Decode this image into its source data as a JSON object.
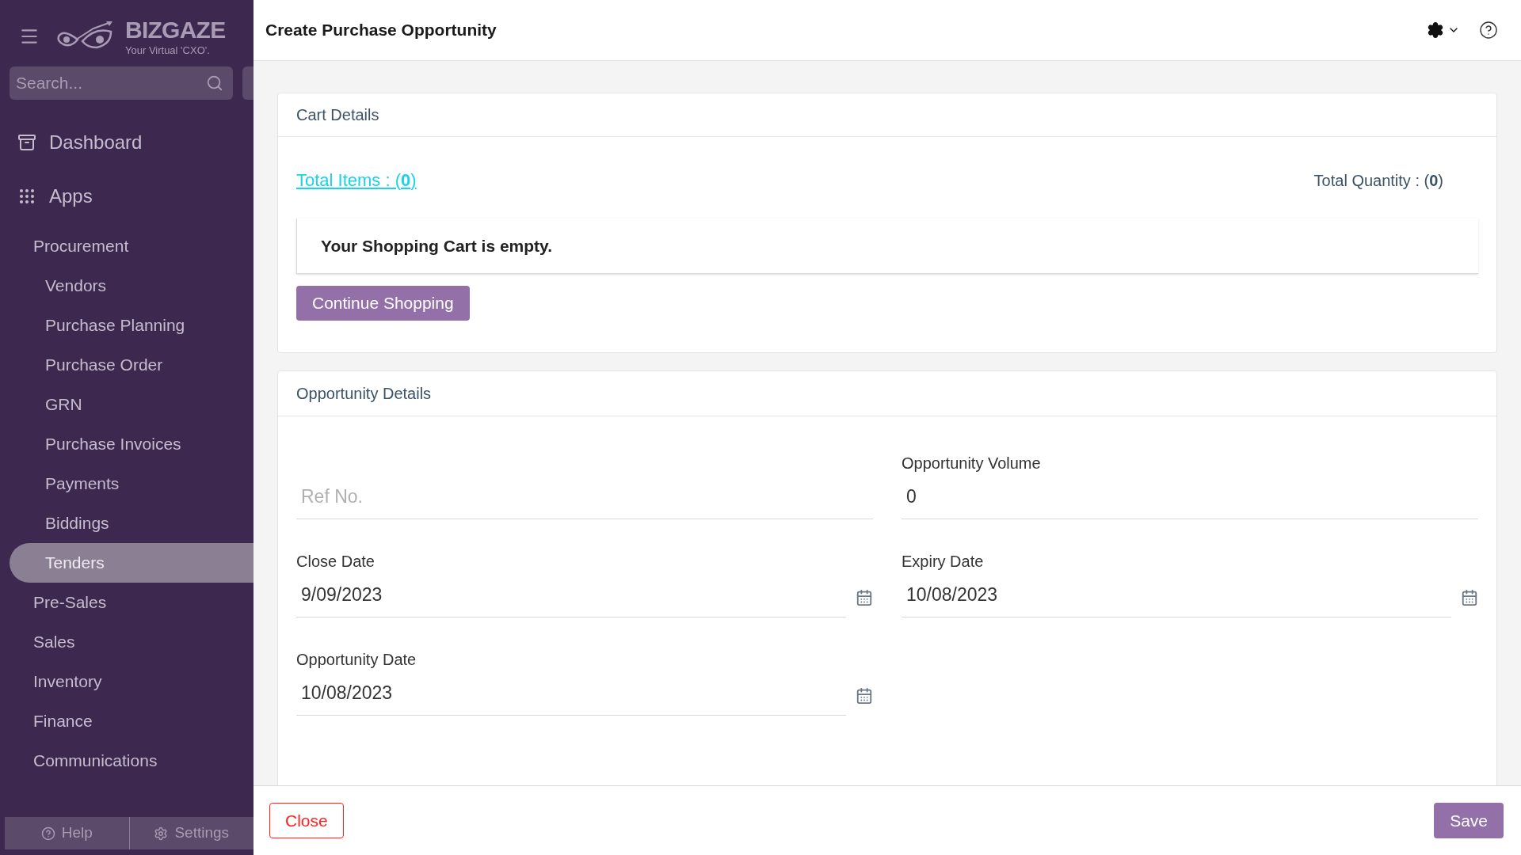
{
  "sidebar": {
    "logo": {
      "name": "BIZGAZE",
      "tagline": "Your Virtual 'CXO'."
    },
    "search": {
      "placeholder": "Search..."
    },
    "sections": [
      {
        "kind": "dashboard",
        "label": "Dashboard"
      },
      {
        "kind": "apps",
        "label": "Apps"
      }
    ],
    "menu": [
      {
        "label": "Procurement",
        "selected": false,
        "children": [
          {
            "label": "Vendors",
            "selected": false
          },
          {
            "label": "Purchase Planning",
            "selected": false
          },
          {
            "label": "Purchase Order",
            "selected": false
          },
          {
            "label": "GRN",
            "selected": false
          },
          {
            "label": "Purchase Invoices",
            "selected": false
          },
          {
            "label": "Payments",
            "selected": false
          },
          {
            "label": "Biddings",
            "selected": false
          },
          {
            "label": "Tenders",
            "selected": true
          }
        ]
      },
      {
        "label": "Pre-Sales",
        "selected": false
      },
      {
        "label": "Sales",
        "selected": false
      },
      {
        "label": "Inventory",
        "selected": false
      },
      {
        "label": "Finance",
        "selected": false
      },
      {
        "label": "Communications",
        "selected": false
      }
    ],
    "footer": [
      {
        "kind": "help",
        "label": "Help"
      },
      {
        "kind": "settings",
        "label": "Settings"
      }
    ]
  },
  "header": {
    "title": "Create Purchase Opportunity"
  },
  "cart": {
    "title": "Cart Details",
    "total_items": "Total Items : (**0**)",
    "total_quantity": "Total Quantity : (**0**)",
    "empty_message": "Your Shopping Cart is empty.",
    "button": "Continue Shopping"
  },
  "opportunity": {
    "title": "Opportunity Details",
    "ref_no": {
      "placeholder": "Ref No."
    },
    "fields": [
      {
        "kind": "text",
        "label": "Opportunity Volume",
        "value": "0"
      },
      {
        "kind": "date",
        "label": "Close Date",
        "value": "9/09/2023"
      },
      {
        "kind": "date",
        "label": "Expiry Date",
        "value": "10/08/2023"
      },
      {
        "kind": "date",
        "label": "Opportunity Date",
        "value": "10/08/2023"
      }
    ]
  },
  "actions": {
    "close": "Close",
    "save": "Save"
  }
}
